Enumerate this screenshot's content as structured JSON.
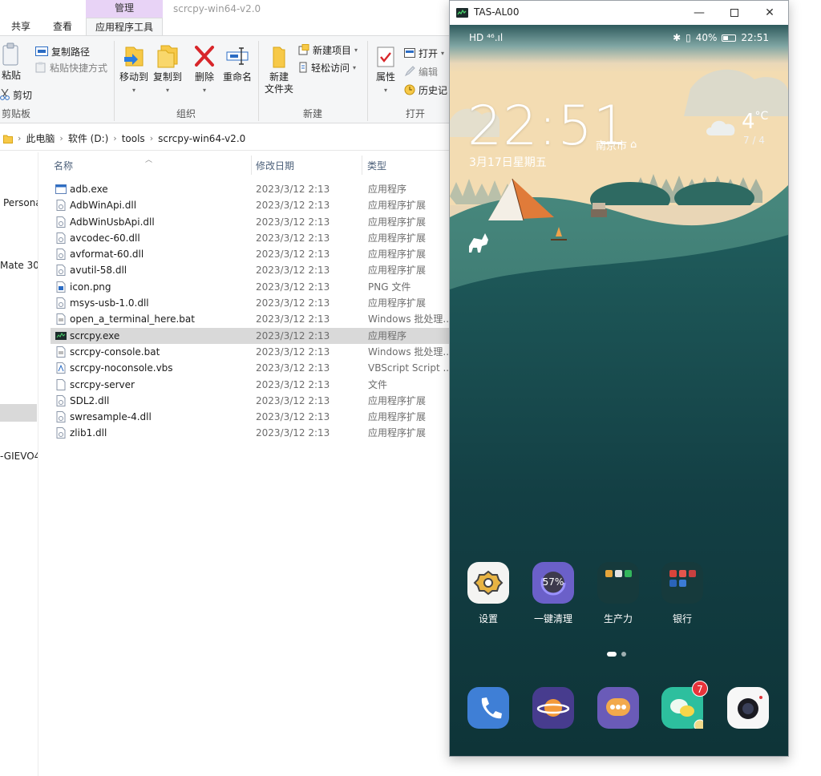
{
  "explorer": {
    "title_ghost": "scrcpy-win64-v2.0",
    "tabs": {
      "share": "共享",
      "view": "查看",
      "manage_band": "管理",
      "app_tools": "应用程序工具"
    },
    "ribbon": {
      "paste": "粘贴",
      "copy_path": "复制路径",
      "paste_shortcut": "粘贴快捷方式",
      "cut": "剪切",
      "clipboard_group": "剪贴板",
      "move_to": "移动到",
      "copy_to": "复制到",
      "delete": "删除",
      "rename": "重命名",
      "organize_group": "组织",
      "new_folder_1": "新建",
      "new_folder_2": "文件夹",
      "new_item": "新建项目",
      "easy_access": "轻松访问",
      "new_group": "新建",
      "properties": "属性",
      "open": "打开",
      "edit": "编辑",
      "history": "历史记",
      "open_group": "打开"
    },
    "breadcrumb": [
      "此电脑",
      "软件 (D:)",
      "tools",
      "scrcpy-win64-v2.0"
    ],
    "nav_items": [
      "Persona",
      "Mate 30",
      "-GIEVO4"
    ],
    "columns": {
      "name": "名称",
      "date": "修改日期",
      "type": "类型"
    },
    "files": [
      {
        "name": "adb.exe",
        "date": "2023/3/12 2:13",
        "type": "应用程序",
        "icon": "exe"
      },
      {
        "name": "AdbWinApi.dll",
        "date": "2023/3/12 2:13",
        "type": "应用程序扩展",
        "icon": "dll"
      },
      {
        "name": "AdbWinUsbApi.dll",
        "date": "2023/3/12 2:13",
        "type": "应用程序扩展",
        "icon": "dll"
      },
      {
        "name": "avcodec-60.dll",
        "date": "2023/3/12 2:13",
        "type": "应用程序扩展",
        "icon": "dll"
      },
      {
        "name": "avformat-60.dll",
        "date": "2023/3/12 2:13",
        "type": "应用程序扩展",
        "icon": "dll"
      },
      {
        "name": "avutil-58.dll",
        "date": "2023/3/12 2:13",
        "type": "应用程序扩展",
        "icon": "dll"
      },
      {
        "name": "icon.png",
        "date": "2023/3/12 2:13",
        "type": "PNG 文件",
        "icon": "png"
      },
      {
        "name": "msys-usb-1.0.dll",
        "date": "2023/3/12 2:13",
        "type": "应用程序扩展",
        "icon": "dll"
      },
      {
        "name": "open_a_terminal_here.bat",
        "date": "2023/3/12 2:13",
        "type": "Windows 批处理...",
        "icon": "bat"
      },
      {
        "name": "scrcpy.exe",
        "date": "2023/3/12 2:13",
        "type": "应用程序",
        "icon": "scrcpy"
      },
      {
        "name": "scrcpy-console.bat",
        "date": "2023/3/12 2:13",
        "type": "Windows 批处理...",
        "icon": "bat"
      },
      {
        "name": "scrcpy-noconsole.vbs",
        "date": "2023/3/12 2:13",
        "type": "VBScript Script ...",
        "icon": "vbs"
      },
      {
        "name": "scrcpy-server",
        "date": "2023/3/12 2:13",
        "type": "文件",
        "icon": "file"
      },
      {
        "name": "SDL2.dll",
        "date": "2023/3/12 2:13",
        "type": "应用程序扩展",
        "icon": "dll"
      },
      {
        "name": "swresample-4.dll",
        "date": "2023/3/12 2:13",
        "type": "应用程序扩展",
        "icon": "dll"
      },
      {
        "name": "zlib1.dll",
        "date": "2023/3/12 2:13",
        "type": "应用程序扩展",
        "icon": "dll"
      }
    ],
    "selected_file": "scrcpy.exe"
  },
  "scrcpy": {
    "window_title": "TAS-AL00",
    "status": {
      "left": "HD ⁴⁶.ıl",
      "battery": "40%",
      "time": "22:51"
    },
    "lockclock": {
      "time": "22:51",
      "city": "南京市",
      "date": "3月17日星期五",
      "temp": "4",
      "temp_unit": "°C",
      "temp_range": "7 / 4"
    },
    "apps_row": [
      {
        "label": "设置",
        "icon": "settings-icon"
      },
      {
        "label": "一键清理",
        "icon": "cleanup-icon",
        "value": "57%"
      },
      {
        "label": "生产力",
        "icon": "folder-icon"
      },
      {
        "label": "银行",
        "icon": "folder-icon"
      }
    ],
    "dock": [
      {
        "icon": "phone-icon"
      },
      {
        "icon": "browser-planet-icon"
      },
      {
        "icon": "chat-bubble-icon"
      },
      {
        "icon": "wechat-icon",
        "badge": "7"
      },
      {
        "icon": "camera-icon"
      }
    ],
    "colors": {
      "accent_tent": "#e07b39",
      "sea_dark": "#0f3b40",
      "sky": "#a9c1c0"
    }
  }
}
